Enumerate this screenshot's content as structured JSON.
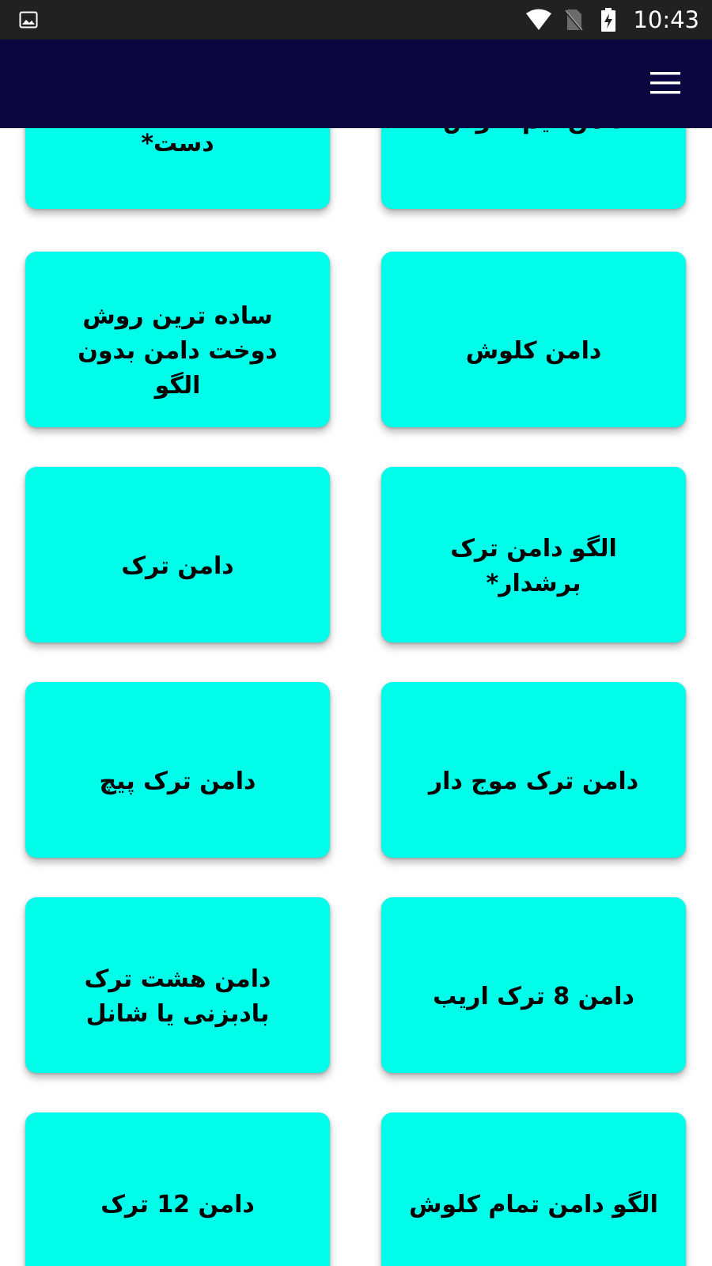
{
  "status_bar": {
    "time": "10:43",
    "icons": [
      "image-icon",
      "wifi-icon",
      "no-sim-icon",
      "battery-charging-icon"
    ]
  },
  "app_bar": {
    "background": "#090640",
    "menu_icon": "hamburger-menu-icon"
  },
  "colors": {
    "card_background": "#00fdea",
    "status_bar": "#212121"
  },
  "items": [
    {
      "label": "دست*",
      "column": "left"
    },
    {
      "label": "دامن نیم کلوش",
      "column": "right"
    },
    {
      "label": "ساده ترین روش دوخت دامن بدون الگو",
      "column": "left"
    },
    {
      "label": "دامن کلوش",
      "column": "right"
    },
    {
      "label": "دامن ترک",
      "column": "left"
    },
    {
      "label": "الگو دامن ترک برشدار*",
      "column": "right"
    },
    {
      "label": "دامن ترک پیچ",
      "column": "left"
    },
    {
      "label": "دامن ترک موج دار",
      "column": "right"
    },
    {
      "label": "دامن هشت ترک بادبزنی یا شانل",
      "column": "left"
    },
    {
      "label": "دامن 8 ترک اریب",
      "column": "right"
    },
    {
      "label": "دامن 12 ترک",
      "column": "left"
    },
    {
      "label": "الگو دامن تمام کلوش",
      "column": "right"
    }
  ]
}
